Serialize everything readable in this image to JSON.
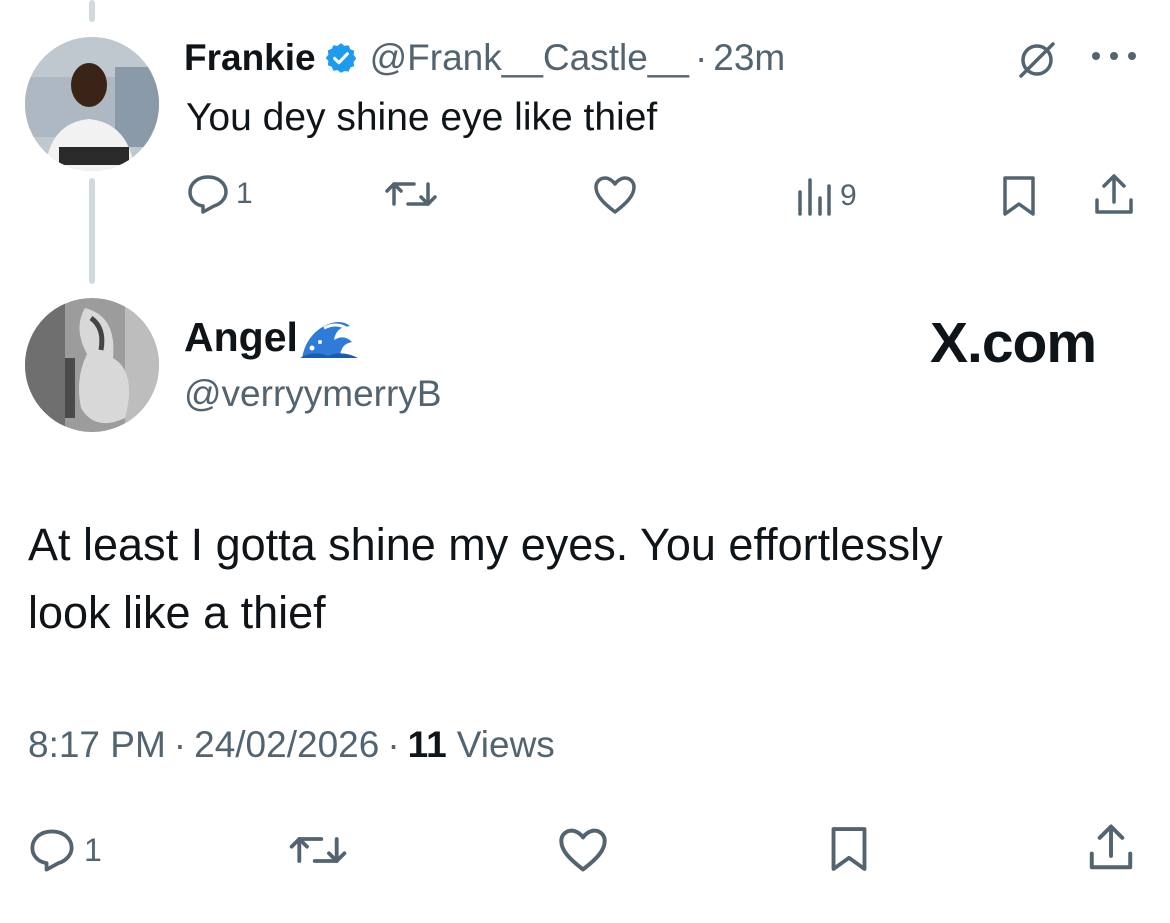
{
  "reply_parent": {
    "display_name": "Frankie",
    "handle": "@Frank__Castle__",
    "separator": "·",
    "age": "23m",
    "text": "You dey shine eye like thief",
    "actions": {
      "replies": "1",
      "views": "9"
    }
  },
  "main_post": {
    "display_name": "Angel",
    "emoji_icon": "wave-emoji-icon",
    "handle": "@verryymerryB",
    "watermark": "X.com",
    "text_line1": "At least I gotta shine my eyes. You effortlessly",
    "text_line2": "look like a thief",
    "time": "8:17 PM",
    "dot1": "·",
    "date": "24/02/2026",
    "dot2": "·",
    "views_count": "11",
    "views_label": "Views",
    "actions": {
      "replies": "1"
    }
  },
  "colors": {
    "text": "#0f1419",
    "muted": "#536471",
    "verified": "#1d9bf0",
    "thread": "#cfd9de"
  }
}
